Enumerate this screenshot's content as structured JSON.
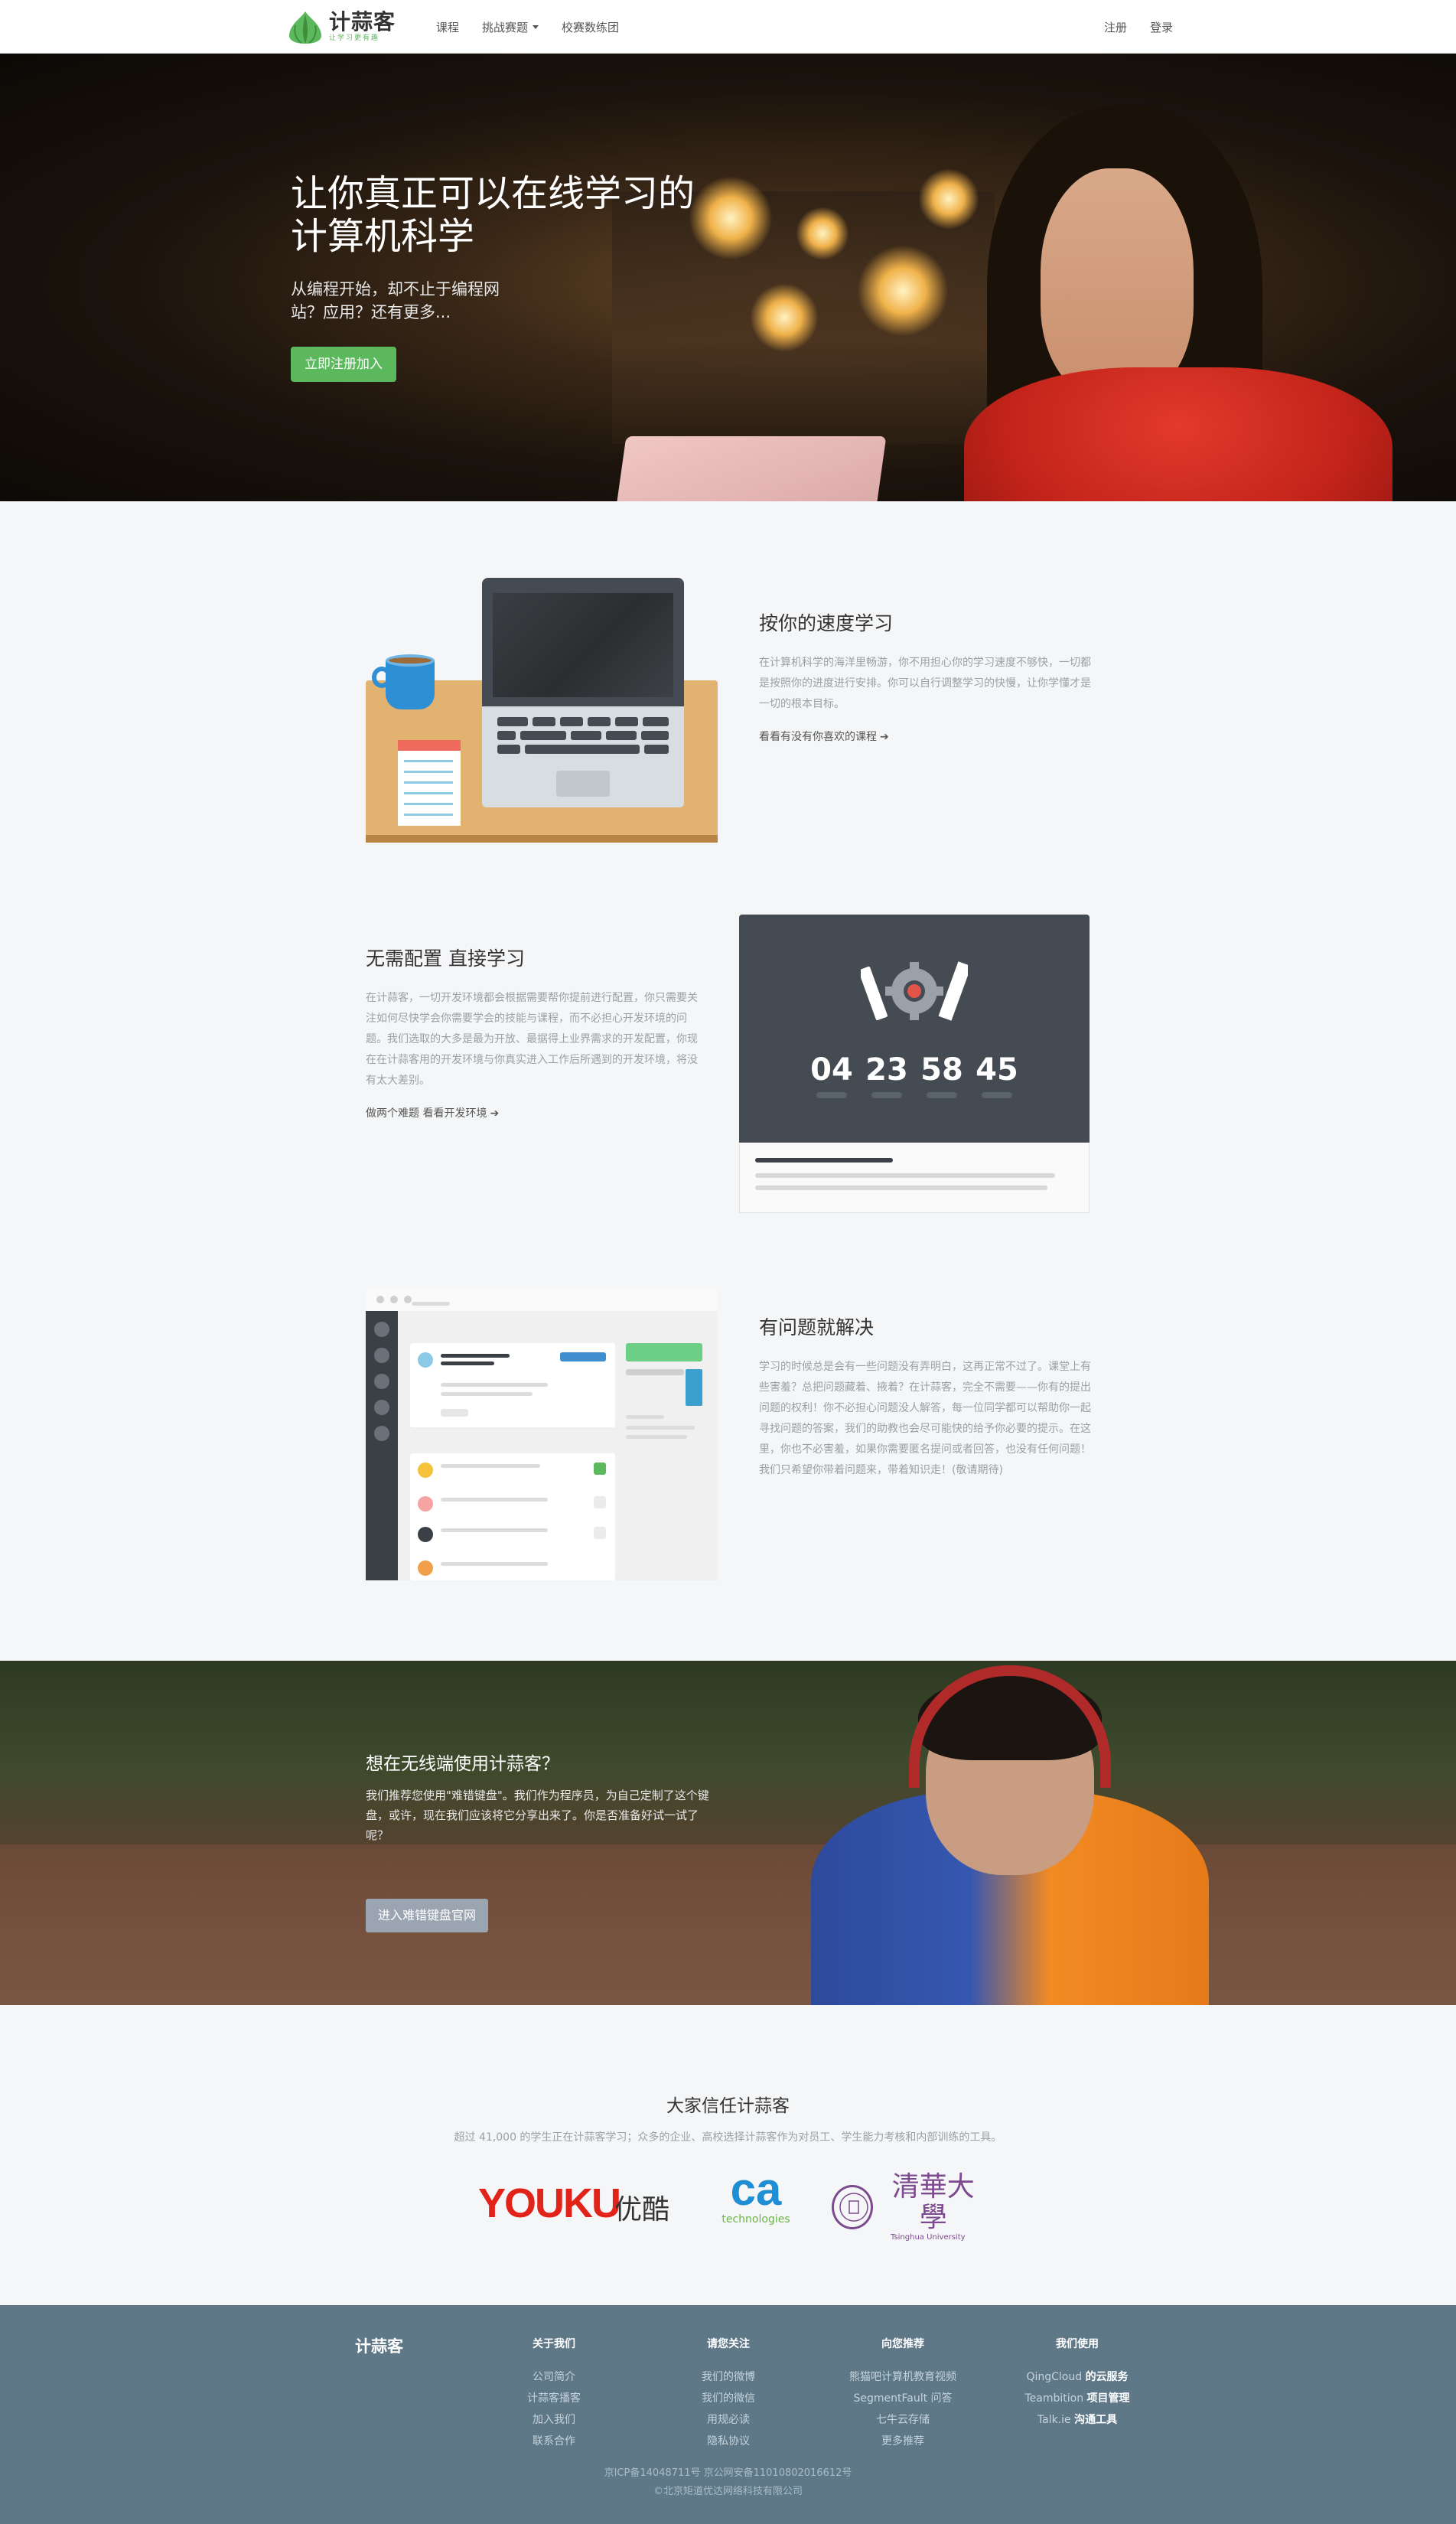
{
  "navbar": {
    "logo_title": "计蒜客",
    "logo_sub": "让学习更有趣",
    "links": [
      "课程",
      "挑战赛题",
      "校赛数练团"
    ],
    "signup": "注册",
    "login": "登录"
  },
  "hero": {
    "title_line1": "让你真正可以在线学习的",
    "title_line2": "计算机科学",
    "subtitle": "从编程开始，却不止于编程网站？应用？还有更多...",
    "cta": "立即注册加入"
  },
  "features": [
    {
      "title": "按你的速度学习",
      "desc": "在计算机科学的海洋里畅游，你不用担心你的学习速度不够快，一切都是按照你的进度进行安排。你可以自行调整学习的快慢，让你学懂才是一切的根本目标。",
      "link": "看看有没有你喜欢的课程"
    },
    {
      "title": "无需配置 直接学习",
      "desc": "在计蒜客，一切开发环境都会根据需要帮你提前进行配置，你只需要关注如何尽快学会你需要学会的技能与课程，而不必担心开发环境的问题。我们选取的大多是最为开放、最据得上业界需求的开发配置，你现在在计蒜客用的开发环境与你真实进入工作后所遇到的开发环境，将没有太大差别。",
      "link": "做两个难题 看看开发环境"
    },
    {
      "title": "有问题就解决",
      "desc": "学习的时候总是会有一些问题没有弄明白，这再正常不过了。课堂上有些害羞？总把问题藏着、掖着？在计蒜客，完全不需要——你有的提出问题的权利！你不必担心问题没人解答，每一位同学都可以帮助你一起寻找问题的答案，我们的助教也会尽可能快的给予你必要的提示。在这里，你也不必害羞，如果你需要匿名提问或者回答，也没有任何问题！我们只希望你带着问题来，带着知识走！(敬请期待)",
      "link": ""
    }
  ],
  "countdown": [
    "04",
    "23",
    "58",
    "45"
  ],
  "mobile": {
    "title": "想在无线端使用计蒜客？",
    "desc": "我们推荐您使用\"难错键盘\"。我们作为程序员，为自己定制了这个键盘，或许，现在我们应该将它分享出来了。你是否准备好试一试了呢？",
    "button": "进入难错键盘官网"
  },
  "trust": {
    "title": "大家信任计蒜客",
    "subtitle": "超过 41,000 的学生正在计蒜客学习；众多的企业、高校选择计蒜客作为对员工、学生能力考核和内部训练的工具。",
    "logos": {
      "youku": "YOUKU",
      "youku_cn": "优酷",
      "ca": "ca",
      "ca_sub": "technologies",
      "thu": "清華大學",
      "thu_en": "Tsinghua University"
    }
  },
  "footer": {
    "brand": "计蒜客",
    "columns": [
      {
        "title": "关于我们",
        "items": [
          "公司简介",
          "计蒜客播客",
          "加入我们",
          "联系合作"
        ]
      },
      {
        "title": "请您关注",
        "items": [
          "我们的微博",
          "我们的微信",
          "用规必读",
          "隐私协议"
        ]
      },
      {
        "title": "向您推荐",
        "items": [
          "熊猫吧计算机教育视频",
          "SegmentFault 问答",
          "七牛云存储",
          "更多推荐"
        ]
      },
      {
        "title": "我们使用",
        "items_a": [
          "QingCloud",
          "Teambition",
          "Talk.ie"
        ],
        "items_b": [
          "的云服务",
          "项目管理",
          "沟通工具"
        ]
      }
    ],
    "icp": "京ICP备14048711号  京公网安备11010802016612号",
    "copyright": "©北京矩道优达网络科技有限公司"
  },
  "colors": {
    "brand_green": "#5cb85c",
    "footer_bg": "#5e7888",
    "dark_panel": "#444b52"
  }
}
